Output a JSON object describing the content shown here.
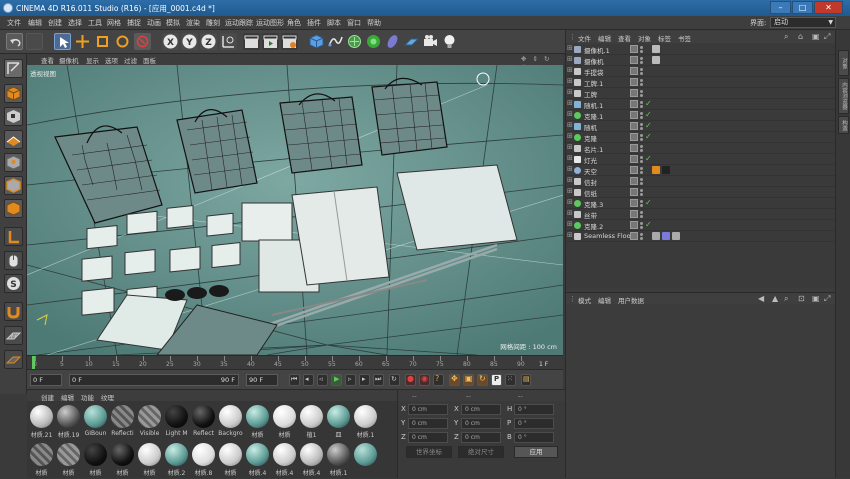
{
  "window": {
    "title": "CINEMA 4D R16.011 Studio (R16) - [应用_0001.c4d *]",
    "minimize": "–",
    "maximize": "□",
    "close": "✕"
  },
  "menu": [
    "文件",
    "编辑",
    "创建",
    "选择",
    "工具",
    "网格",
    "捕捉",
    "动画",
    "模拟",
    "渲染",
    "雕刻",
    "运动跟踪",
    "运动图形",
    "角色",
    "插件",
    "脚本",
    "窗口",
    "帮助"
  ],
  "layout": {
    "label": "界面:",
    "value": "启动"
  },
  "viewport": {
    "menu": [
      "查看",
      "摄像机",
      "显示",
      "选项",
      "过滤",
      "面板"
    ],
    "label": "透视视图",
    "grid_spacing": "网格间距 : 100 cm"
  },
  "timeline": {
    "ticks": [
      "0",
      "5",
      "10",
      "15",
      "20",
      "25",
      "30",
      "35",
      "40",
      "45",
      "50",
      "55",
      "60",
      "65",
      "70",
      "75",
      "80",
      "85",
      "90"
    ],
    "end_label": "1 F"
  },
  "playback": {
    "start_frame": "0 F",
    "current_frame": "0 F",
    "range_end": "90 F",
    "end_frame": "90 F"
  },
  "materials": {
    "menu": [
      "创建",
      "编辑",
      "功能",
      "纹理"
    ],
    "row1": [
      "材质.21",
      "材质.19",
      "GIBoun",
      "Reflecti",
      "Visible",
      "Light M",
      "Reflect",
      "Backgro",
      "材质",
      "材质",
      "植1",
      "皿",
      "材质.1"
    ],
    "row2": [
      "材质",
      "材质",
      "材质",
      "材质",
      "材质",
      "材质.2",
      "材质.8",
      "材质",
      "材质.4",
      "材质.4",
      "材质.4",
      "材质.1",
      ""
    ]
  },
  "coordinates": {
    "headers": [
      "--",
      "--",
      "--"
    ],
    "rows": [
      {
        "axis": "X",
        "pos": "0 cm",
        "axis2": "X",
        "size": "0 cm",
        "axis3": "H",
        "rot": "0 °"
      },
      {
        "axis": "Y",
        "pos": "0 cm",
        "axis2": "Y",
        "size": "0 cm",
        "axis3": "P",
        "rot": "0 °"
      },
      {
        "axis": "Z",
        "pos": "0 cm",
        "axis2": "Z",
        "size": "0 cm",
        "axis3": "B",
        "rot": "0 °"
      }
    ],
    "mode1": "世界坐标",
    "mode2": "绝对尺寸",
    "apply": "应用"
  },
  "object_manager": {
    "menu": [
      "文件",
      "编辑",
      "查看",
      "对象",
      "标签",
      "书签"
    ],
    "objects": [
      {
        "name": "摄像机.1",
        "icon": "camera-icon",
        "color": "#9aa8c0",
        "tags": 1,
        "check": ""
      },
      {
        "name": "摄像机",
        "icon": "camera-icon",
        "color": "#9aa8c0",
        "tags": 1,
        "check": ""
      },
      {
        "name": "手提袋",
        "icon": "null-icon",
        "color": "#c8c8c8",
        "tags": 0,
        "check": ""
      },
      {
        "name": "工牌.1",
        "icon": "null-icon",
        "color": "#c8c8c8",
        "tags": 0,
        "check": ""
      },
      {
        "name": "工牌",
        "icon": "null-icon",
        "color": "#c8c8c8",
        "tags": 0,
        "check": ""
      },
      {
        "name": "随机.1",
        "icon": "random-icon",
        "color": "#7fb4d8",
        "tags": 0,
        "check": "✓"
      },
      {
        "name": "克隆.1",
        "icon": "cloner-icon",
        "color": "#5ec85e",
        "tags": 0,
        "check": "✓"
      },
      {
        "name": "随机",
        "icon": "random-icon",
        "color": "#7fb4d8",
        "tags": 0,
        "check": "✓"
      },
      {
        "name": "克隆",
        "icon": "cloner-icon",
        "color": "#5ec85e",
        "tags": 0,
        "check": "✓"
      },
      {
        "name": "名片.1",
        "icon": "null-icon",
        "color": "#c8c8c8",
        "tags": 0,
        "check": ""
      },
      {
        "name": "灯光",
        "icon": "light-icon",
        "color": "#e8e8e8",
        "tags": 0,
        "check": "✓"
      },
      {
        "name": "天空",
        "icon": "sky-icon",
        "color": "#8fb0d8",
        "tags": 2,
        "check": ""
      },
      {
        "name": "信封",
        "icon": "null-icon",
        "color": "#c8c8c8",
        "tags": 0,
        "check": ""
      },
      {
        "name": "信纸",
        "icon": "null-icon",
        "color": "#c8c8c8",
        "tags": 0,
        "check": ""
      },
      {
        "name": "克隆.3",
        "icon": "cloner-icon",
        "color": "#5ec85e",
        "tags": 0,
        "check": "✓"
      },
      {
        "name": "丝带",
        "icon": "null-icon",
        "color": "#c8c8c8",
        "tags": 0,
        "check": ""
      },
      {
        "name": "克隆.2",
        "icon": "cloner-icon",
        "color": "#5ec85e",
        "tags": 0,
        "check": "✓"
      },
      {
        "name": "Seamless Floor",
        "icon": "null-icon",
        "color": "#c8c8c8",
        "tags": 3,
        "check": ""
      }
    ]
  },
  "attribute_manager": {
    "menu": [
      "模式",
      "编辑",
      "用户数据"
    ]
  },
  "side_tabs": [
    "对象",
    "内容浏览器",
    "构造"
  ],
  "colors": {
    "viewport_bg": "#5f8a86",
    "title_bar": "#2d6da8",
    "panel": "#3c3c3c",
    "accent_check": "#5ec85e"
  }
}
